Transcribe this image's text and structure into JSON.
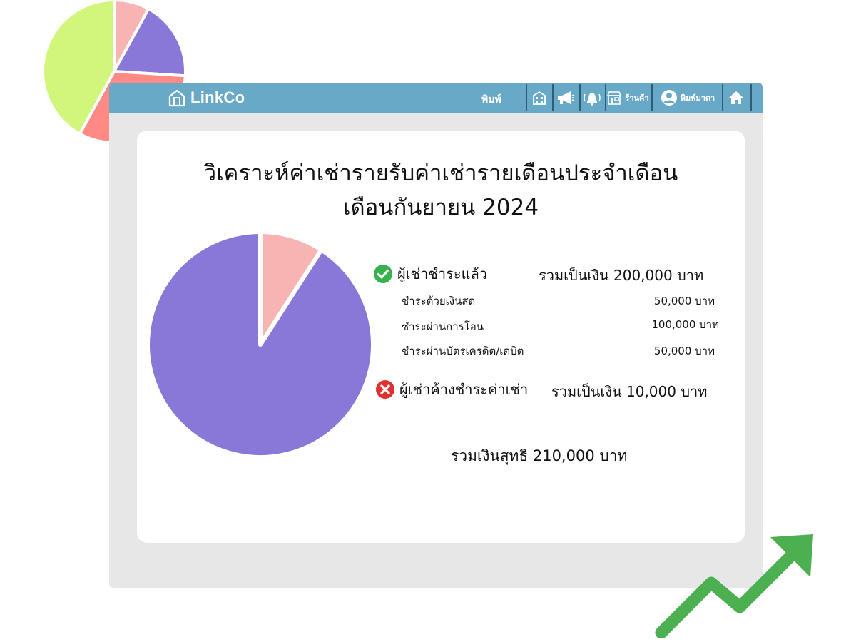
{
  "navbar": {
    "logo_text": "LinkCo",
    "print_label": "พิมพ์",
    "shop_label": "ร้านค้า",
    "user_label": "พิมพ์มาดา",
    "icons": [
      "building-icon",
      "megaphone-icon",
      "bell-icon",
      "shop-icon",
      "user-icon",
      "home-icon"
    ]
  },
  "report": {
    "title_line1": "วิเคราะห์ค่าเช่ารายรับค่าเช่ารายเดือนประจำเดือน",
    "title_line2": "เดือนกันยายน 2024"
  },
  "paid": {
    "label": "ผู้เช่าชำระแล้ว",
    "total": "รวมเป็นเงิน 200,000 บาท",
    "items": [
      {
        "label": "ชำระด้วยเงินสด",
        "value": "50,000 บาท"
      },
      {
        "label": "ชำระผ่านการโอน",
        "value": "100,000 บาท"
      },
      {
        "label": "ชำระผ่านบัตรเครดิต/เดบิต",
        "value": "50,000 บาท"
      }
    ]
  },
  "unpaid": {
    "label": "ผู้เช่าค้างชำระค่าเช่า",
    "total": "รวมเป็นเงิน 10,000 บาท"
  },
  "net_total": "รวมเงินสุทธิ 210,000 บาท",
  "colors": {
    "navbar": "#67a9c6",
    "paid": "#8a78d8",
    "unpaid": "#f8b3b3",
    "check": "#37b24d",
    "cross": "#e03131",
    "arrow": "#4caf50"
  },
  "chart_data": [
    {
      "type": "pie",
      "slices": [
        {
          "label": "ผู้เช่าชำระแล้ว",
          "value": 200000,
          "color": "#8a78d8"
        },
        {
          "label": "ผู้เช่าค้างชำระค่าเช่า",
          "value": 20000,
          "color": "#f8b3b3"
        }
      ]
    },
    {
      "type": "pie",
      "slices": [
        {
          "value": 8,
          "color": "#f8b3b3"
        },
        {
          "value": 18,
          "color": "#8a78d8"
        },
        {
          "value": 32,
          "color": "#ff8a84"
        },
        {
          "value": 42,
          "color": "#d2f57b"
        }
      ]
    }
  ]
}
